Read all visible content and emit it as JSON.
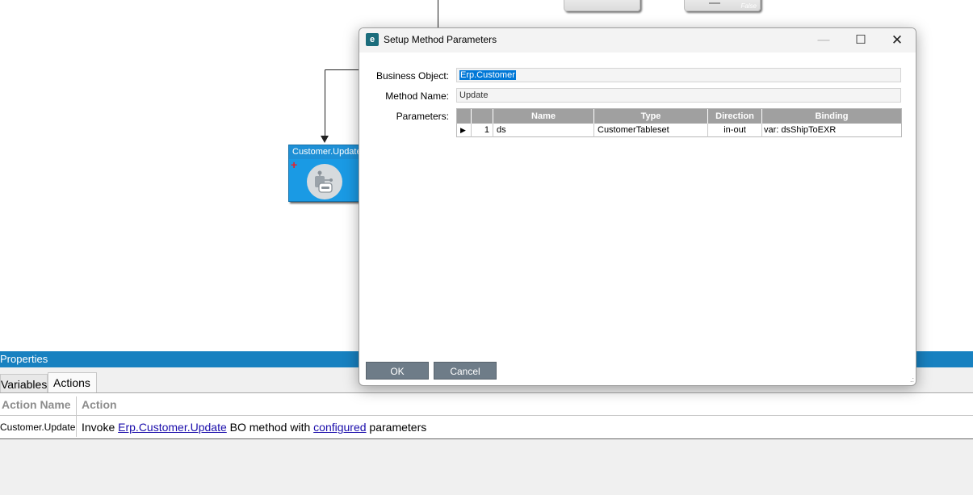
{
  "canvas": {
    "top_node_false_label": "False",
    "node": {
      "title": "Customer.Update",
      "plus_glyph": "+",
      "icon": "bpm-method-icon"
    }
  },
  "dialog": {
    "title": "Setup Method Parameters",
    "app_icon": "e",
    "minimize_glyph": "—",
    "maximize_glyph": "☐",
    "close_glyph": "✕",
    "business_object_label": "Business Object:",
    "business_object_value": "Erp.Customer",
    "method_name_label": "Method Name:",
    "method_name_value": "Update",
    "parameters_label": "Parameters:",
    "table": {
      "headers": {
        "name": "Name",
        "type": "Type",
        "direction": "Direction",
        "binding": "Binding"
      },
      "rows": [
        {
          "indicator": "▶",
          "index": "1",
          "name": "ds",
          "type": "CustomerTableset",
          "direction": "in-out",
          "binding": "var: dsShipToEXR"
        }
      ]
    },
    "ok_label": "OK",
    "cancel_label": "Cancel",
    "resize_grip": ".:"
  },
  "properties": {
    "title": "Properties",
    "tabs": [
      "Variables",
      "Actions"
    ],
    "active_tab": "Actions",
    "columns": {
      "action_name": "Action Name",
      "action": "Action"
    },
    "row": {
      "action_name": "Customer.Update",
      "action_prefix": "Invoke ",
      "action_link1": "Erp.Customer.Update",
      "action_middle": " BO method with ",
      "action_link2": "configured",
      "action_suffix": " parameters"
    }
  },
  "colors": {
    "accent": "#1881c0",
    "node_blue": "#1e90d6",
    "selection": "#0078d7",
    "button": "#6e7c88"
  }
}
